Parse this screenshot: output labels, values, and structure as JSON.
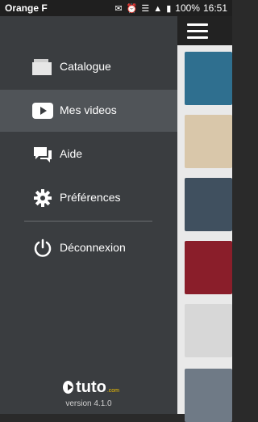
{
  "status_bar": {
    "carrier": "Orange F",
    "battery": "100%",
    "time": "16:51"
  },
  "menu": {
    "items": [
      {
        "label": "Catalogue",
        "icon": "catalogue-icon"
      },
      {
        "label": "Mes videos",
        "icon": "play-icon",
        "active": true
      },
      {
        "label": "Aide",
        "icon": "chat-icon"
      },
      {
        "label": "Préférences",
        "icon": "gear-icon"
      },
      {
        "label": "Déconnexion",
        "icon": "power-icon"
      }
    ]
  },
  "brand": {
    "logo_text": "tuto",
    "logo_suffix": ".com",
    "version": "version 4.1.0"
  },
  "thumbnails": [
    {
      "color": "#2f6f8f"
    },
    {
      "color": "#d9c7aa"
    },
    {
      "color": "#40505f"
    },
    {
      "color": "#8a1e2a"
    },
    {
      "color": "#d7d7d7"
    },
    {
      "color": "#6f7a86"
    }
  ]
}
